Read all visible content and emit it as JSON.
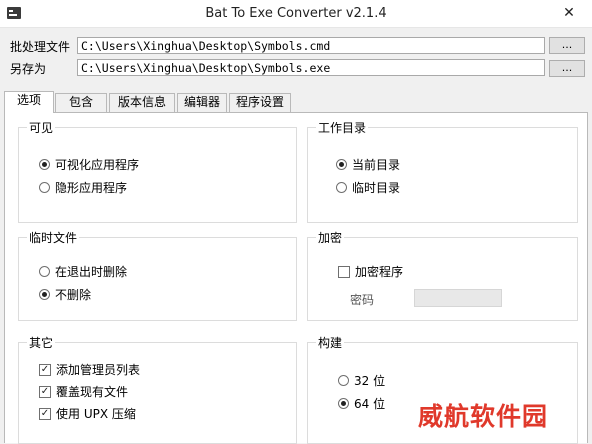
{
  "window": {
    "title": "Bat To Exe Converter v2.1.4",
    "close": "✕"
  },
  "files": {
    "batch_label": "批处理文件",
    "batch_path": "C:\\Users\\Xinghua\\Desktop\\Symbols.cmd",
    "saveas_label": "另存为",
    "saveas_path": "C:\\Users\\Xinghua\\Desktop\\Symbols.exe",
    "browse": "..."
  },
  "tabs": [
    "选项",
    "包含",
    "版本信息",
    "编辑器",
    "程序设置"
  ],
  "visibility": {
    "title": "可见",
    "options": [
      "可视化应用程序",
      "隐形应用程序"
    ],
    "selected": 0
  },
  "workdir": {
    "title": "工作目录",
    "options": [
      "当前目录",
      "临时目录"
    ],
    "selected": 0
  },
  "tempfiles": {
    "title": "临时文件",
    "options": [
      "在退出时删除",
      "不删除"
    ],
    "selected": 1
  },
  "encrypt": {
    "title": "加密",
    "checkbox": "加密程序",
    "checked": false,
    "password_label": "密码"
  },
  "misc": {
    "title": "其它",
    "options": [
      "添加管理员列表",
      "覆盖现有文件",
      "使用 UPX 压缩"
    ],
    "checked": [
      true,
      true,
      true
    ]
  },
  "build": {
    "title": "构建",
    "options": [
      "32 位",
      "64 位"
    ],
    "selected": 1
  },
  "watermark": "威航软件园"
}
